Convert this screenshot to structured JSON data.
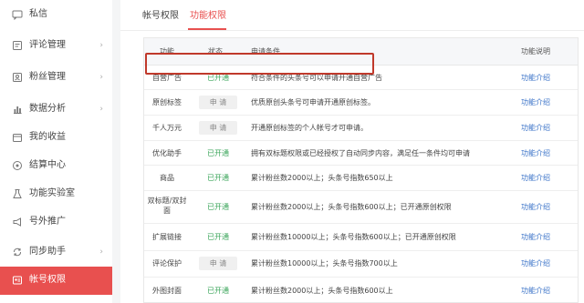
{
  "sidebar": {
    "items": [
      {
        "label": "私信",
        "icon": "message-icon",
        "chevron": false,
        "active": false
      },
      {
        "label": "评论管理",
        "icon": "comment-icon",
        "chevron": true,
        "active": false
      },
      {
        "label": "粉丝管理",
        "icon": "fans-icon",
        "chevron": true,
        "active": false
      },
      {
        "label": "数据分析",
        "icon": "chart-icon",
        "chevron": true,
        "active": false
      },
      {
        "label": "我的收益",
        "icon": "wallet-icon",
        "chevron": false,
        "active": false
      },
      {
        "label": "结算中心",
        "icon": "settlement-icon",
        "chevron": false,
        "active": false
      },
      {
        "label": "功能实验室",
        "icon": "lab-icon",
        "chevron": false,
        "active": false
      },
      {
        "label": "号外推广",
        "icon": "megaphone-icon",
        "chevron": false,
        "active": false
      },
      {
        "label": "同步助手",
        "icon": "sync-icon",
        "chevron": true,
        "active": false
      },
      {
        "label": "帐号权限",
        "icon": "account-icon",
        "chevron": false,
        "active": true
      }
    ],
    "chevron_glyph": "›"
  },
  "tabs": [
    {
      "label": "帐号权限",
      "active": false
    },
    {
      "label": "功能权限",
      "active": true
    }
  ],
  "table": {
    "headers": {
      "func": "功能",
      "status": "状态",
      "cond": "申请条件",
      "desc": "功能说明"
    },
    "rows": [
      {
        "func": "自营广告",
        "status": "已开通",
        "status_type": "open",
        "cond": "符合条件的头条号可以申请开通自营广告",
        "link": "功能介绍"
      },
      {
        "func": "原创标签",
        "status": "申 请",
        "status_type": "apply",
        "cond": "优质原创头条号可申请开通原创标签。",
        "link": "功能介绍"
      },
      {
        "func": "千人万元",
        "status": "申 请",
        "status_type": "apply",
        "cond": "开通原创标签的个人帐号才可申请。",
        "link": "功能介绍"
      },
      {
        "func": "优化助手",
        "status": "已开通",
        "status_type": "open",
        "cond": "拥有双标题权限或已经授权了自动同步内容，满足任一条件均可申请",
        "link": "功能介绍"
      },
      {
        "func": "商品",
        "status": "已开通",
        "status_type": "open",
        "cond": "累计粉丝数2000以上；头条号指数650以上",
        "link": "功能介绍"
      },
      {
        "func": "双标题/双封面",
        "status": "已开通",
        "status_type": "open",
        "cond": "累计粉丝数2000以上；头条号指数600以上；已开通原创权限",
        "link": "功能介绍"
      },
      {
        "func": "扩展链接",
        "status": "已开通",
        "status_type": "open",
        "cond": "累计粉丝数10000以上；头条号指数600以上；已开通原创权限",
        "link": "功能介绍"
      },
      {
        "func": "评论保护",
        "status": "申 请",
        "status_type": "apply",
        "cond": "累计粉丝数10000以上；头条号指数700以上",
        "link": "功能介绍"
      },
      {
        "func": "外图封面",
        "status": "已开通",
        "status_type": "open",
        "cond": "累计粉丝数2000以上；头条号指数600以上",
        "link": "功能介绍"
      }
    ]
  },
  "colors": {
    "accent": "#e8504f",
    "open": "#3aa55a",
    "link": "#3b73c8",
    "highlight": "#c0392b"
  }
}
